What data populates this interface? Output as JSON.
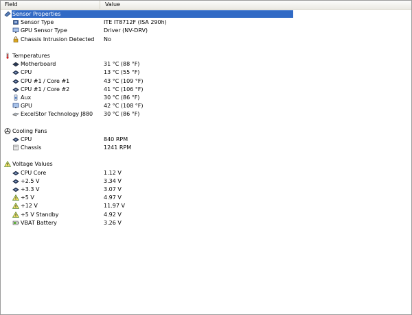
{
  "header": {
    "field_label": "Field",
    "value_label": "Value"
  },
  "rows": [
    {
      "type": "group",
      "label": "Sensor Properties",
      "icon": "sensor-properties-icon",
      "selected": true
    },
    {
      "type": "item",
      "label": "Sensor Type",
      "value": "ITE IT8712F  (ISA 290h)",
      "icon": "chip-icon"
    },
    {
      "type": "item",
      "label": "GPU Sensor Type",
      "value": "Driver  (NV-DRV)",
      "icon": "monitor-icon"
    },
    {
      "type": "item",
      "label": "Chassis Intrusion Detected",
      "value": "No",
      "icon": "lock-icon"
    },
    {
      "type": "blank"
    },
    {
      "type": "group",
      "label": "Temperatures",
      "icon": "thermometer-icon"
    },
    {
      "type": "item",
      "label": "Motherboard",
      "value": "31 °C  (88 °F)",
      "icon": "board-icon"
    },
    {
      "type": "item",
      "label": "CPU",
      "value": "13 °C  (55 °F)",
      "icon": "cpu-icon"
    },
    {
      "type": "item",
      "label": "CPU #1 / Core #1",
      "value": "43 °C  (109 °F)",
      "icon": "cpu-icon"
    },
    {
      "type": "item",
      "label": "CPU #1 / Core #2",
      "value": "41 °C  (106 °F)",
      "icon": "cpu-icon"
    },
    {
      "type": "item",
      "label": "Aux",
      "value": "30 °C  (86 °F)",
      "icon": "aux-icon"
    },
    {
      "type": "item",
      "label": "GPU",
      "value": "42 °C  (108 °F)",
      "icon": "monitor-icon"
    },
    {
      "type": "item",
      "label": "ExcelStor Technology J880",
      "value": "30 °C  (86 °F)",
      "icon": "hard-drive-icon"
    },
    {
      "type": "blank"
    },
    {
      "type": "group",
      "label": "Cooling Fans",
      "icon": "fan-icon"
    },
    {
      "type": "item",
      "label": "CPU",
      "value": "840 RPM",
      "icon": "cpu-icon"
    },
    {
      "type": "item",
      "label": "Chassis",
      "value": "1241 RPM",
      "icon": "chassis-icon"
    },
    {
      "type": "blank"
    },
    {
      "type": "group",
      "label": "Voltage Values",
      "icon": "voltage-warning-icon"
    },
    {
      "type": "item",
      "label": "CPU Core",
      "value": "1.12 V",
      "icon": "cpu-icon"
    },
    {
      "type": "item",
      "label": "+2.5 V",
      "value": "3.34 V",
      "icon": "cpu-icon"
    },
    {
      "type": "item",
      "label": "+3.3 V",
      "value": "3.07 V",
      "icon": "cpu-icon"
    },
    {
      "type": "item",
      "label": "+5 V",
      "value": "4.97 V",
      "icon": "voltage-warning-icon"
    },
    {
      "type": "item",
      "label": "+12 V",
      "value": "11.97 V",
      "icon": "voltage-warning-icon"
    },
    {
      "type": "item",
      "label": "+5 V Standby",
      "value": "4.92 V",
      "icon": "voltage-warning-icon"
    },
    {
      "type": "item",
      "label": "VBAT Battery",
      "value": "3.26 V",
      "icon": "battery-icon"
    }
  ],
  "colors": {
    "selection": "#316ac5",
    "header_bg": "#ebeae4"
  }
}
